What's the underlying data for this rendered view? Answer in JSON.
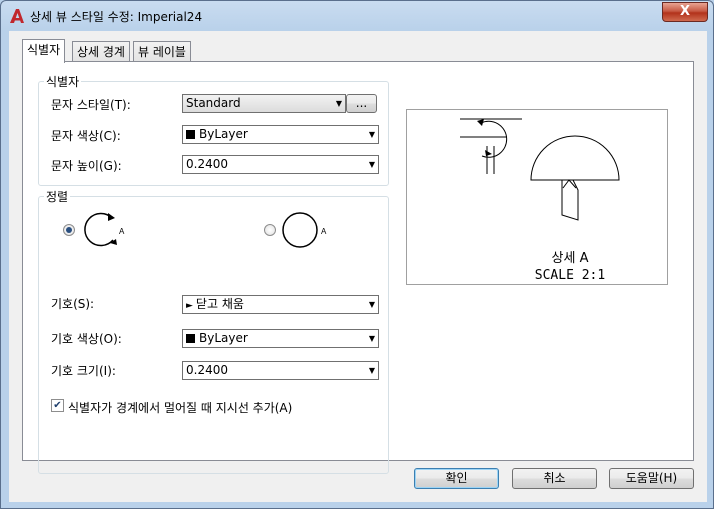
{
  "window": {
    "title": "상세 뷰 스타일 수정: Imperial24",
    "close_label": "X"
  },
  "tabs": [
    {
      "label": "식별자",
      "active": true
    },
    {
      "label": "상세 경계",
      "active": false
    },
    {
      "label": "뷰 레이블",
      "active": false
    }
  ],
  "identifier": {
    "group_title": "식별자",
    "text_style_label": "문자 스타일(T):",
    "text_style_value": "Standard",
    "browse_button": "...",
    "text_color_label": "문자 색상(C):",
    "text_color_value": "ByLayer",
    "text_height_label": "문자 높이(G):",
    "text_height_value": "0.2400"
  },
  "arrangement": {
    "group_title": "정렬",
    "option_letter_1": "A",
    "option_letter_2": "A",
    "symbol_label": "기호(S):",
    "symbol_value": "닫고 채움",
    "symbol_color_label": "기호 색상(O):",
    "symbol_color_value": "ByLayer",
    "symbol_size_label": "기호 크기(I):",
    "symbol_size_value": "0.2400",
    "leader_checkbox_label": "식별자가 경계에서 멀어질 때 지시선 추가(A)",
    "leader_checked": true
  },
  "preview": {
    "label_line1": "상세 A",
    "label_line2": "SCALE 2:1"
  },
  "buttons": {
    "ok": "확인",
    "cancel": "취소",
    "help": "도움말(H)"
  },
  "colors": {
    "swatch": "#000000",
    "app_icon": "#c1272d"
  }
}
